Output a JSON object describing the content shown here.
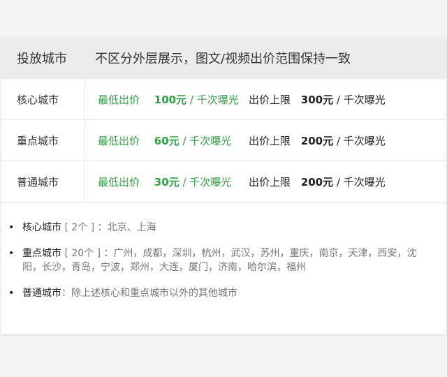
{
  "header": {
    "col1": "投放城市",
    "col2": "不区分外层展示，图文/视频出价范围保持一致"
  },
  "rows": [
    {
      "name": "核心城市",
      "min_label": "最低出价",
      "min_amount": "100元",
      "min_unit": "/ 千次曝光",
      "max_label": "出价上限",
      "max_amount": "300元",
      "max_unit": "/ 千次曝光"
    },
    {
      "name": "重点城市",
      "min_label": "最低出价",
      "min_amount": "60元",
      "min_unit": "/ 千次曝光",
      "max_label": "出价上限",
      "max_amount": "200元",
      "max_unit": "/ 千次曝光"
    },
    {
      "name": "普通城市",
      "min_label": "最低出价",
      "min_amount": "30元",
      "min_unit": "/ 千次曝光",
      "max_label": "出价上限",
      "max_amount": "200元",
      "max_unit": "/ 千次曝光"
    }
  ],
  "notes": [
    {
      "bullet": "•",
      "label": "核心城市",
      "text": " [ 2个 ] ：北京、上海"
    },
    {
      "bullet": "•",
      "label": "重点城市",
      "text": " [ 20个 ] ：广州，成都，深圳，杭州，武汉，苏州，重庆，南京，天津，西安，沈阳，长沙，青岛，宁波，郑州，大连，厦门，济南，哈尔滨，福州"
    },
    {
      "bullet": "•",
      "label": "普通城市",
      "text": "：除上述核心和重点城市以外的其他城市"
    }
  ],
  "colors": {
    "accent_green": "#2ea041",
    "header_bg": "#ececec"
  }
}
